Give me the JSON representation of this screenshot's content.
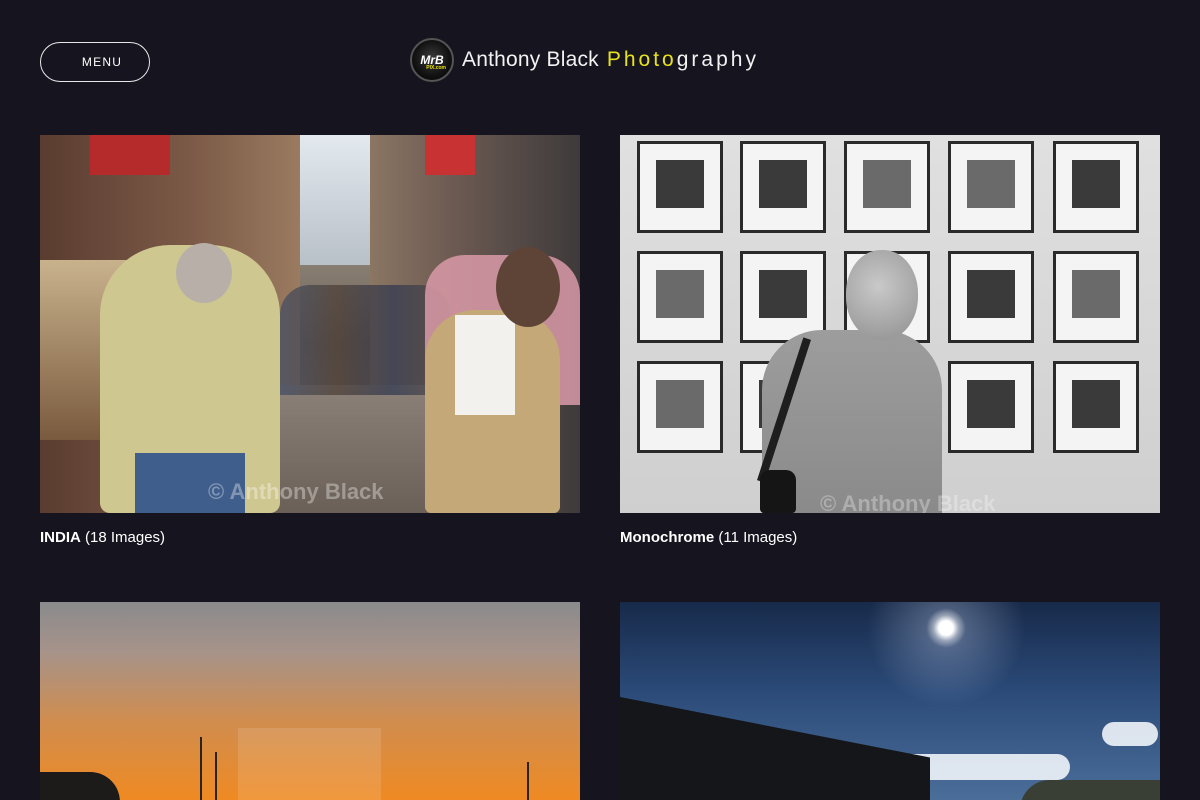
{
  "header": {
    "menu_label": "MENU",
    "logo_badge_text": "MrB",
    "logo_badge_sub": "PIX.com",
    "brand_name": "Anthony Black",
    "brand_photo_highlight": "Photo",
    "brand_photo_rest": "graphy"
  },
  "galleries": [
    {
      "title": "INDIA",
      "count": "(18 Images)",
      "watermark": "© Anthony Black"
    },
    {
      "title": "Monochrome",
      "count": "(11 Images)",
      "watermark": "© Anthony Black"
    },
    {
      "title": "",
      "count": ""
    },
    {
      "title": "",
      "count": ""
    }
  ],
  "colors": {
    "background": "#16151f",
    "accent": "#e7e21b",
    "text": "#ffffff"
  }
}
